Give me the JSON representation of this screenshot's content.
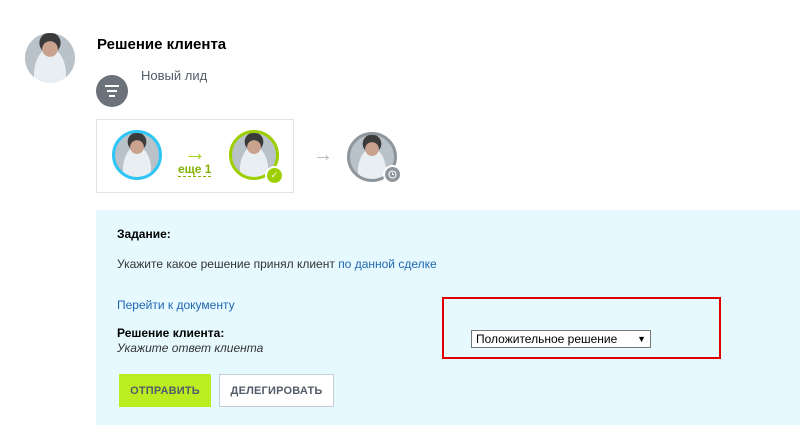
{
  "header": {
    "title": "Решение клиента",
    "stage_label": "Новый лид",
    "stage_icon": "filter-icon"
  },
  "flow": {
    "more_link": "еще 1",
    "colors": {
      "active": "#2fc6f6",
      "done": "#9dcf00",
      "pending": "#8e969d"
    }
  },
  "task": {
    "heading": "Задание:",
    "description_prefix": "Укажите какое решение принял клиент",
    "description_link": "по данной сделке",
    "document_link": "Перейти к документу",
    "decision_label": "Решение клиента:",
    "decision_hint": "Укажите ответ клиента",
    "decision_value": "Положительное решение",
    "panel_color": "#e5f9ff",
    "highlight_color": "#e10000"
  },
  "actions": {
    "send_label": "ОТПРАВИТЬ",
    "delegate_label": "ДЕЛЕГИРОВАТЬ",
    "send_color": "#bbed21"
  }
}
